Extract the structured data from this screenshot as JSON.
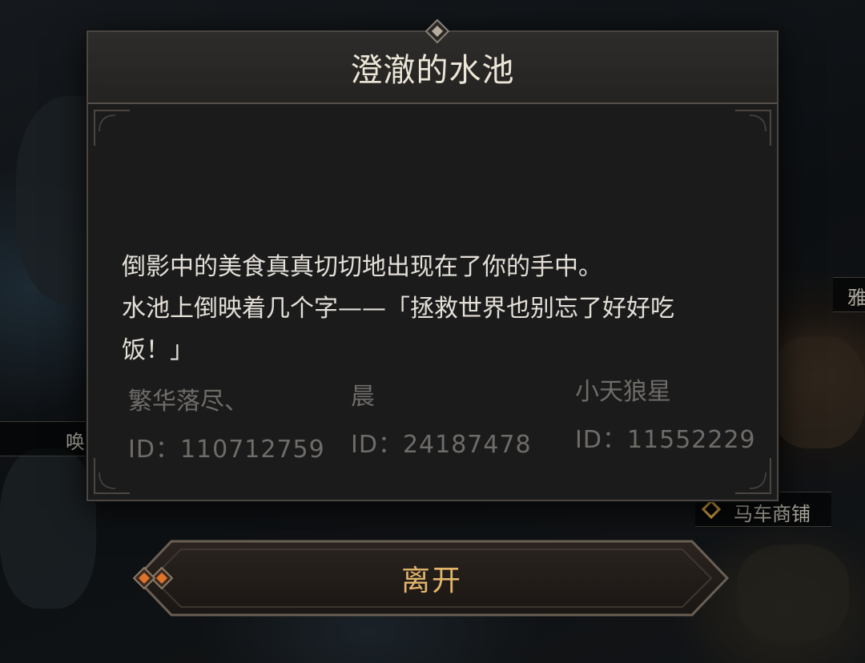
{
  "dialog": {
    "title": "澄澈的水池",
    "message_lines": [
      "倒影中的美食真真切切地出现在了你的手中。",
      "水池上倒映着几个字——「拯救世界也别忘了好好吃",
      "饭！」"
    ],
    "players": [
      {
        "name": "繁华落尽、",
        "id": "ID：110712759"
      },
      {
        "name": "晨",
        "id": "ID：24187478"
      },
      {
        "name": "小天狼星",
        "id": "ID：11552229"
      }
    ]
  },
  "leave_button": {
    "label": "离开"
  },
  "map_labels": {
    "left": "唤",
    "right_edge": "雅",
    "shop": "马车商铺"
  },
  "colors": {
    "title_text": "#ece6d8",
    "body_text": "#e4e0d8",
    "muted_text": "#6f6c68",
    "button_text": "#e2b56a",
    "gem": "#e0732a"
  }
}
